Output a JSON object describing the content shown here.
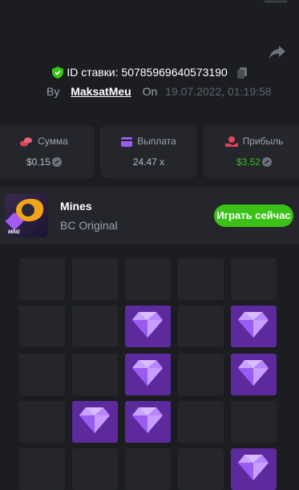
{
  "header": {
    "bet_id_label": "ID ставки:",
    "bet_id": "50785969640573190",
    "by_label": "By",
    "username": "MaksatMeu",
    "on_label": "On",
    "datetime": "19.07.2022, 01:19:58"
  },
  "stats": {
    "amount": {
      "label": "Сумма",
      "value": "$0.15",
      "icon": "coins-icon"
    },
    "payout": {
      "label": "Выплата",
      "value": "24.47 x",
      "icon": "wallet-icon"
    },
    "profit": {
      "label": "Прибыль",
      "value": "$3.52",
      "icon": "hand-coin-icon"
    }
  },
  "game": {
    "title": "Mines",
    "subtitle": "BC Original",
    "thumb_tag": "MINE",
    "play_label": "Играть сейчас"
  },
  "grid": {
    "rows": 5,
    "cols": 5,
    "cells": [
      [
        "empty",
        "empty",
        "empty",
        "empty",
        "empty"
      ],
      [
        "empty",
        "empty",
        "gem",
        "empty",
        "gem"
      ],
      [
        "empty",
        "empty",
        "gem",
        "empty",
        "gem"
      ],
      [
        "empty",
        "gem",
        "gem",
        "empty",
        "empty"
      ],
      [
        "empty",
        "empty",
        "empty",
        "empty",
        "gem"
      ]
    ]
  },
  "colors": {
    "background": "#1b1d21",
    "card": "#24262b",
    "accent_green": "#3bc117",
    "gem_tile": "#5d2a9e"
  }
}
